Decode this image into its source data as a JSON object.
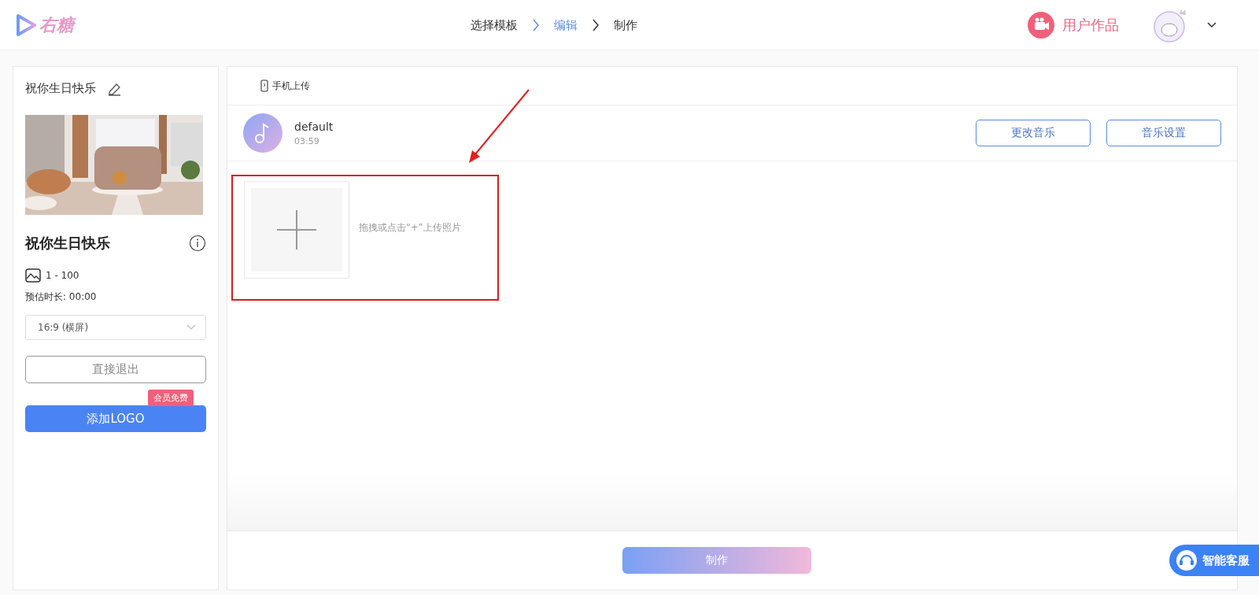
{
  "header": {
    "logo": "右糖",
    "steps": [
      {
        "label": "选择模板",
        "selected": false
      },
      {
        "label": "编辑",
        "selected": true
      },
      {
        "label": "制作",
        "selected": false
      }
    ],
    "user_works": "用户作品"
  },
  "sidebar": {
    "title": "祝你生日快乐",
    "template_name": "祝你生日快乐",
    "photo_range": "1 - 100",
    "duration": "预估时长: 00:00",
    "ratio": {
      "value": "16:9 (横屏)"
    },
    "exit_button": "直接退出",
    "logo_button": "添加LOGO",
    "logo_badge": "会员免费"
  },
  "main": {
    "tabs": [
      {
        "label": "手机上传",
        "selected": false
      }
    ],
    "music": {
      "name": "default",
      "time": "03:59",
      "buttons": [
        "更改音乐",
        "音乐设置"
      ]
    },
    "upload_hint": "拖拽或点击“+”上传照片",
    "make_button": "制作"
  },
  "support_button": "智能客服"
}
